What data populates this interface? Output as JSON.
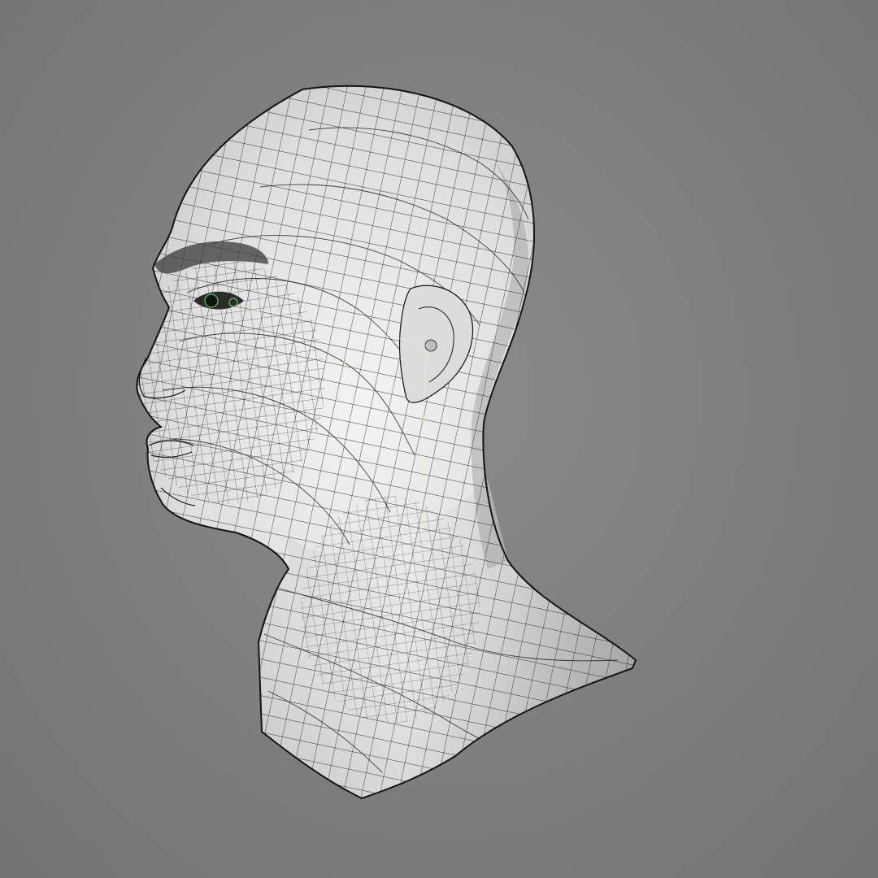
{
  "viewport": {
    "background_color": "#7b7b7b",
    "display_mode": "wireframe-on-shaded"
  },
  "model": {
    "subject": "human-head-bust",
    "view": "three-quarter-left",
    "surface_color": "#e6e6e6",
    "shadow_color": "#8e8e8e",
    "wire_color": "#141414",
    "eye_accent_color": "#4fae4a"
  }
}
